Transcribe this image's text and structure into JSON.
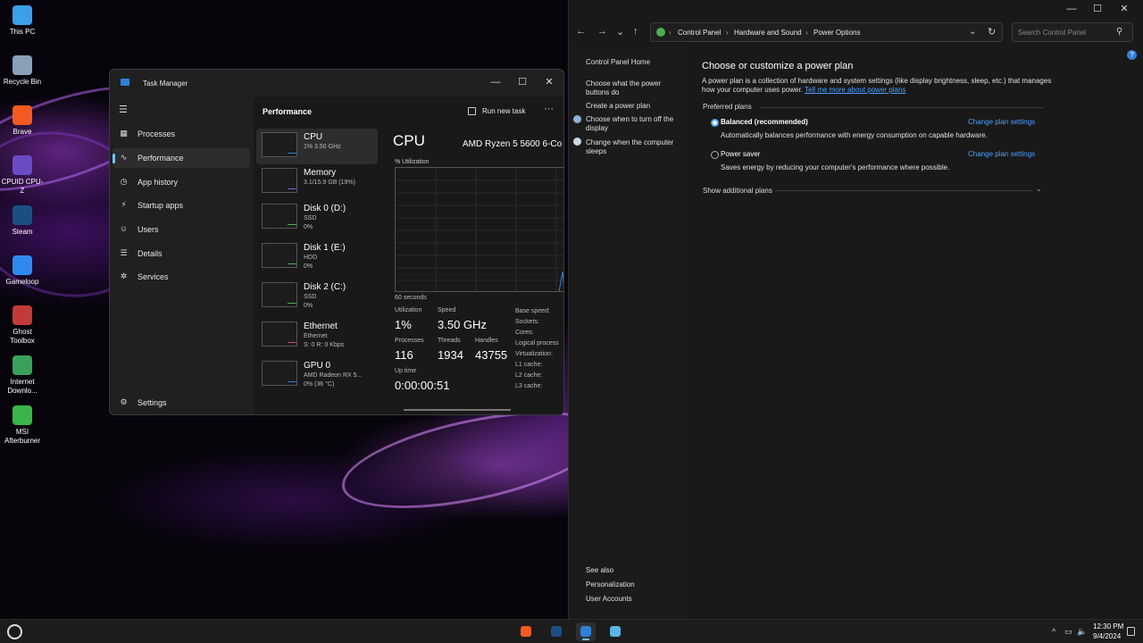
{
  "desktop": {
    "icons": [
      {
        "label": "This PC",
        "icon": "monitor-icon",
        "color": "#3aa0e8"
      },
      {
        "label": "Recycle Bin",
        "icon": "recycle-bin-icon",
        "color": "#8aa0b8"
      },
      {
        "label": "Brave",
        "icon": "brave-icon",
        "color": "#f25a22"
      },
      {
        "label": "CPUID CPU-Z",
        "icon": "cpuz-icon",
        "color": "#6a4bc4"
      },
      {
        "label": "Steam",
        "icon": "steam-icon",
        "color": "#1b4f82"
      },
      {
        "label": "Gameloop",
        "icon": "gameloop-icon",
        "color": "#2d8bf0"
      },
      {
        "label": "Ghost Toolbox",
        "icon": "ghost-toolbox-icon",
        "color": "#c23a3a"
      },
      {
        "label": "Internet Downlo...",
        "icon": "internet-download-icon",
        "color": "#3aa05a"
      },
      {
        "label": "MSI Afterburner",
        "icon": "msi-afterburner-icon",
        "color": "#39b54a"
      }
    ]
  },
  "taskmgr": {
    "title": "Task Manager",
    "controls": {
      "minimize": "—",
      "maximize": "☐",
      "close": "✕"
    },
    "hamburger": "☰",
    "nav": [
      {
        "label": "Processes",
        "icon": "processes-icon",
        "glyph": "▦"
      },
      {
        "label": "Performance",
        "icon": "performance-icon",
        "glyph": "∿"
      },
      {
        "label": "App history",
        "icon": "app-history-icon",
        "glyph": "◷"
      },
      {
        "label": "Startup apps",
        "icon": "startup-apps-icon",
        "glyph": "⚡"
      },
      {
        "label": "Users",
        "icon": "users-icon",
        "glyph": "☺"
      },
      {
        "label": "Details",
        "icon": "details-icon",
        "glyph": "☰"
      },
      {
        "label": "Services",
        "icon": "services-icon",
        "glyph": "✲"
      }
    ],
    "settings_label": "Settings",
    "settings_glyph": "⚙",
    "header": "Performance",
    "run_new_task": "Run new task",
    "more": "···",
    "resources": [
      {
        "name": "CPU",
        "sub1": "1% 3.50 GHz",
        "sub2": "",
        "sub3": "",
        "graph_color": "#2f80d8"
      },
      {
        "name": "Memory",
        "sub1": "3.1/15.9 GB (19%)",
        "sub2": "",
        "sub3": "",
        "graph_color": "#8a5cd8"
      },
      {
        "name": "Disk 0 (D:)",
        "sub1": "SSD",
        "sub2": "0%",
        "sub3": "",
        "graph_color": "#4caf50"
      },
      {
        "name": "Disk 1 (E:)",
        "sub1": "HDD",
        "sub2": "0%",
        "sub3": "",
        "graph_color": "#4caf50"
      },
      {
        "name": "Disk 2 (C:)",
        "sub1": "SSD",
        "sub2": "0%",
        "sub3": "",
        "graph_color": "#4caf50"
      },
      {
        "name": "Ethernet",
        "sub1": "Ethernet",
        "sub2": "S: 0 R: 0 Kbps",
        "sub3": "",
        "graph_color": "#c24a6a"
      },
      {
        "name": "GPU 0",
        "sub1": "AMD Radeon RX 5...",
        "sub2": "0% (36 °C)",
        "sub3": "",
        "graph_color": "#2f80d8"
      }
    ],
    "cpu": {
      "title": "CPU",
      "model": "AMD Ryzen 5 5600 6-Co",
      "util_label": "% Utilization",
      "graph_seconds": "60 seconds",
      "utilization_label": "Utilization",
      "utilization": "1%",
      "speed_label": "Speed",
      "speed": "3.50 GHz",
      "processes_label": "Processes",
      "processes": "116",
      "threads_label": "Threads",
      "threads": "1934",
      "handles_label": "Handles",
      "handles": "43755",
      "uptime_label": "Up time",
      "uptime": "0:00:00:51",
      "specs": [
        "Base speed:",
        "Sockets:",
        "Cores:",
        "Logical process",
        "Virtualization:",
        "L1 cache:",
        "L2 cache:",
        "L3 cache:"
      ]
    }
  },
  "controlpanel": {
    "controls": {
      "minimize": "—",
      "maximize": "☐",
      "close": "✕"
    },
    "nav": {
      "back": "←",
      "forward": "→",
      "recent": "⌄",
      "up": "↑",
      "dropdown": "⌄",
      "refresh": "↻"
    },
    "breadcrumb": [
      "Control Panel",
      "Hardware and Sound",
      "Power Options"
    ],
    "breadcrumb_sep": "›",
    "search_placeholder": "Search Control Panel",
    "left_links": [
      {
        "text": "Control Panel Home"
      },
      {
        "text": "Choose what the power buttons do"
      },
      {
        "text": "Create a power plan"
      },
      {
        "text": "Choose when to turn off the display"
      },
      {
        "text": "Change when the computer sleeps"
      }
    ],
    "see_also": {
      "heading": "See also",
      "links": [
        "Personalization",
        "User Accounts"
      ]
    },
    "main": {
      "title": "Choose or customize a power plan",
      "desc": "A power plan is a collection of hardware and system settings (like display brightness, sleep, etc.) that manages how your computer uses power.",
      "desc_link": "Tell me more about power plans",
      "preferred_label": "Preferred plans",
      "plans": [
        {
          "name": "Balanced (recommended)",
          "desc": "Automatically balances performance with energy consumption on capable hardware.",
          "link": "Change plan settings",
          "selected": true
        },
        {
          "name": "Power saver",
          "desc": "Saves energy by reducing your computer's performance where possible.",
          "link": "Change plan settings",
          "selected": false
        }
      ],
      "show_additional": "Show additional plans",
      "chevron": "⌄"
    },
    "help": "?"
  },
  "taskbar": {
    "apps": [
      {
        "name": "Brave",
        "icon": "brave-icon",
        "color": "#f25a22"
      },
      {
        "name": "Steam",
        "icon": "steam-icon",
        "color": "#1b4f82"
      },
      {
        "name": "Task Manager",
        "icon": "task-manager-icon",
        "color": "#2f80d8"
      },
      {
        "name": "Control Panel",
        "icon": "control-panel-icon",
        "color": "#5ab4e8"
      }
    ],
    "tray": {
      "chevron": "^",
      "network": "▭",
      "volume": "🔈"
    },
    "time": "12:30 PM",
    "date": "9/4/2024",
    "accent": "#6cc4ff"
  }
}
